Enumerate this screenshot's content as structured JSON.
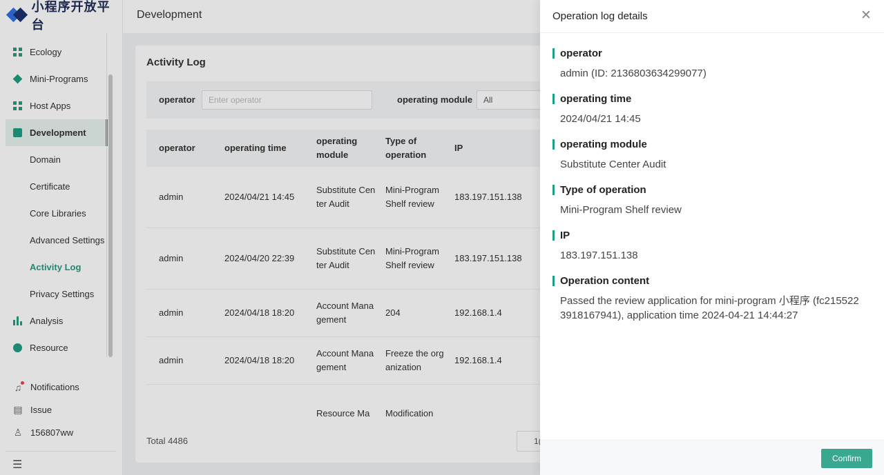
{
  "sidebar": {
    "logo_text": "小程序开放平台",
    "items": [
      {
        "label": "Ecology"
      },
      {
        "label": "Mini-Programs"
      },
      {
        "label": "Host Apps"
      },
      {
        "label": "Development"
      },
      {
        "label": "Domain"
      },
      {
        "label": "Certificate"
      },
      {
        "label": "Core Libraries"
      },
      {
        "label": "Advanced Settings"
      },
      {
        "label": "Activity Log"
      },
      {
        "label": "Privacy Settings"
      },
      {
        "label": "Analysis"
      },
      {
        "label": "Resource"
      }
    ],
    "bottom": {
      "notifications": "Notifications",
      "issue": "Issue",
      "user": "156807ww"
    }
  },
  "header": {
    "title": "Development"
  },
  "main": {
    "card_title": "Activity Log",
    "filter": {
      "operator_label": "operator",
      "operator_placeholder": "Enter operator",
      "module_label": "operating module",
      "module_value": "All"
    },
    "columns": [
      "operator",
      "operating time",
      "operating module",
      "Type of operation",
      "IP"
    ],
    "rows": [
      {
        "operator": "admin",
        "time": "2024/04/21 14:45",
        "module": "Substitute Center Audit",
        "type": "Mini-Program Shelf review",
        "ip": "183.197.151.138"
      },
      {
        "operator": "admin",
        "time": "2024/04/20 22:39",
        "module": "Substitute Center Audit",
        "type": "Mini-Program Shelf review",
        "ip": "183.197.151.138"
      },
      {
        "operator": "admin",
        "time": "2024/04/18 18:20",
        "module": "Account Management",
        "type": "204",
        "ip": "192.168.1.4"
      },
      {
        "operator": "admin",
        "time": "2024/04/18 18:20",
        "module": "Account Management",
        "type": "Freeze the organization",
        "ip": "192.168.1.4"
      },
      {
        "operator": "",
        "time": "",
        "module": "Resource Ma",
        "type": "Modification",
        "ip": ""
      }
    ],
    "total": "Total 4486",
    "page_size": "1("
  },
  "drawer": {
    "title": "Operation log details",
    "fields": [
      {
        "label": "operator",
        "value": "admin (ID: 2136803634299077)"
      },
      {
        "label": "operating time",
        "value": "2024/04/21 14:45"
      },
      {
        "label": "operating module",
        "value": "Substitute Center Audit"
      },
      {
        "label": "Type of operation",
        "value": "Mini-Program Shelf review"
      },
      {
        "label": "IP",
        "value": "183.197.151.138"
      },
      {
        "label": "Operation content",
        "value": "Passed the review application for mini-program 小程序 (fc215522 3918167941), application time 2024-04-21 14:44:27"
      }
    ],
    "confirm_label": "Confirm"
  },
  "colors": {
    "accent": "#1f9e82",
    "button": "#3aa88e"
  }
}
